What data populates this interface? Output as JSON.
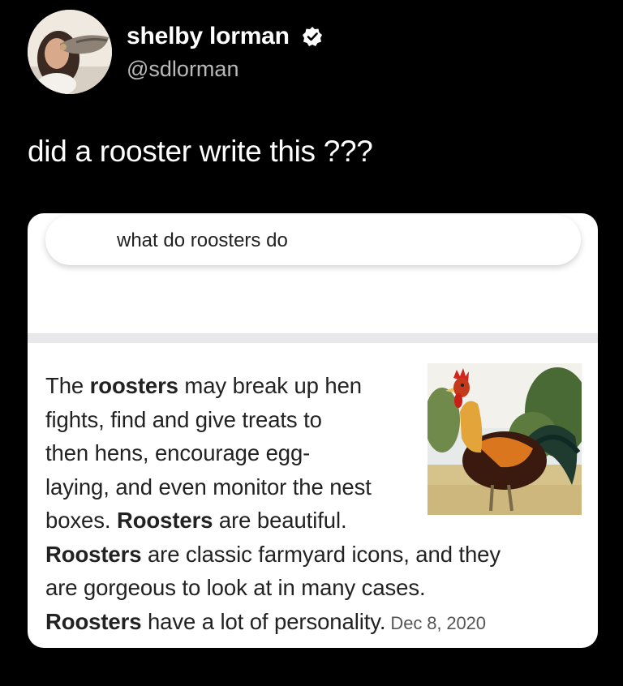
{
  "tweet": {
    "display_name": "shelby lorman",
    "handle": "@sdlorman",
    "verified_icon": "verified-badge-icon",
    "text": "did a rooster write this ???"
  },
  "search": {
    "query": "what do roosters do"
  },
  "snippet": {
    "line1_a": "The ",
    "line1_b": "roosters",
    "line1_c": " may break up hen",
    "line2": "fights, find and give treats to",
    "line3": "then hens, encourage egg-",
    "line4": "laying, and even monitor the nest",
    "line5_a": "boxes. ",
    "line5_b": "Roosters",
    "line5_c": " are beautiful.",
    "line6_a": "Roosters",
    "line6_b": " are classic farmyard icons, and they",
    "line7": "are gorgeous to look at in many cases.",
    "line8_a": "Roosters",
    "line8_b": " have a lot of personality.",
    "date": "Dec 8, 2020"
  },
  "colors": {
    "background": "#000000",
    "card": "#ffffff",
    "handle": "#b9b9b9"
  }
}
